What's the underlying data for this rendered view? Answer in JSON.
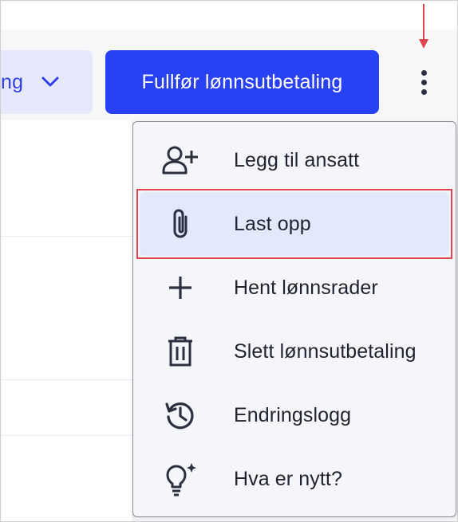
{
  "toolbar": {
    "select_partial_text": "ng",
    "primary_button_label": "Fullfør lønnsutbetaling"
  },
  "menu": {
    "items": [
      {
        "label": "Legg til ansatt",
        "icon": "add-person-icon"
      },
      {
        "label": "Last opp",
        "icon": "paperclip-icon"
      },
      {
        "label": "Hent lønnsrader",
        "icon": "plus-icon"
      },
      {
        "label": "Slett lønnsutbetaling",
        "icon": "trash-icon"
      },
      {
        "label": "Endringslogg",
        "icon": "history-icon"
      },
      {
        "label": "Hva er nytt?",
        "icon": "lightbulb-sparkle-icon"
      }
    ],
    "highlighted_item": "Last opp"
  },
  "colors": {
    "primary": "#2941f5",
    "select_bg": "#e6e9fb",
    "select_text": "#2f40e8",
    "menu_bg": "#f5f6fa",
    "highlight_bg": "#e4e8fb",
    "annotation": "#e0454f",
    "icon": "#2b3040"
  }
}
